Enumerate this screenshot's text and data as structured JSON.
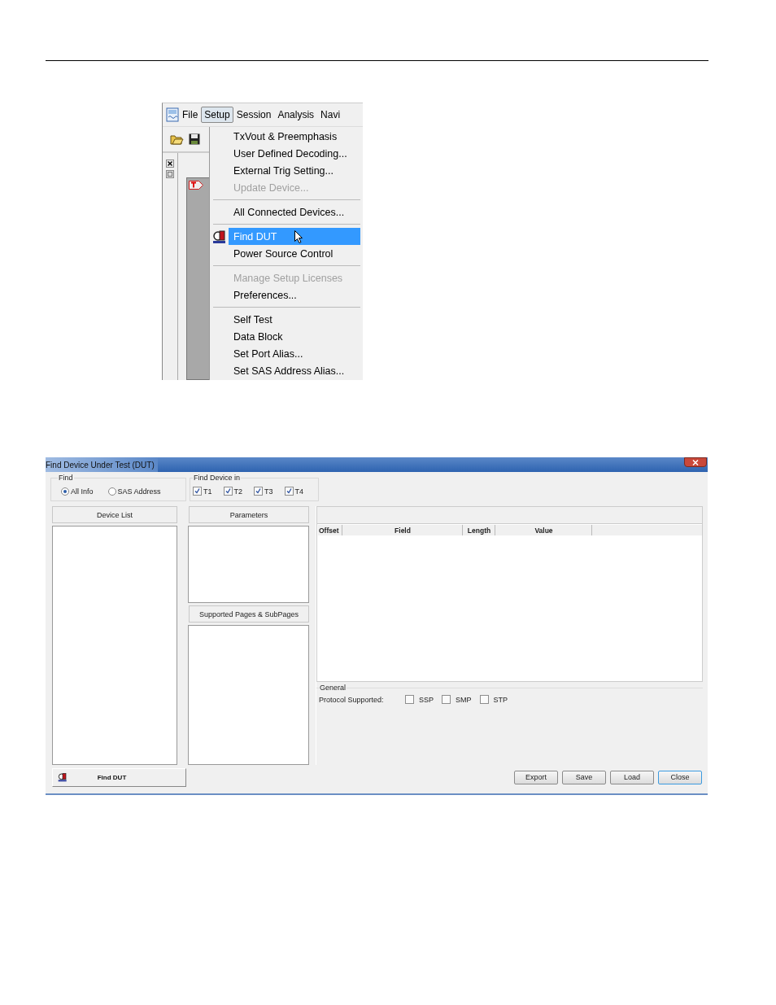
{
  "menu_screenshot": {
    "menubar": [
      {
        "label": "File",
        "selected": false
      },
      {
        "label": "Setup",
        "selected": true
      },
      {
        "label": "Session",
        "selected": false
      },
      {
        "label": "Analysis",
        "selected": false
      },
      {
        "label": "Navi",
        "selected": false
      }
    ],
    "menu_items": [
      {
        "kind": "item",
        "label": "TxVout & Preemphasis",
        "disabled": false,
        "selected": false
      },
      {
        "kind": "item",
        "label": "User Defined Decoding...",
        "disabled": false,
        "selected": false
      },
      {
        "kind": "item",
        "label": "External Trig Setting...",
        "disabled": false,
        "selected": false
      },
      {
        "kind": "item",
        "label": "Update Device...",
        "disabled": true,
        "selected": false
      },
      {
        "kind": "separator"
      },
      {
        "kind": "item",
        "label": "All Connected Devices...",
        "disabled": false,
        "selected": false
      },
      {
        "kind": "separator"
      },
      {
        "kind": "icon_item",
        "label": "Find DUT",
        "disabled": false,
        "selected": true
      },
      {
        "kind": "item",
        "label": "Power Source Control",
        "disabled": false,
        "selected": false
      },
      {
        "kind": "separator"
      },
      {
        "kind": "item",
        "label": "Manage Setup Licenses",
        "disabled": true,
        "selected": false
      },
      {
        "kind": "item",
        "label": "Preferences...",
        "disabled": false,
        "selected": false
      },
      {
        "kind": "separator"
      },
      {
        "kind": "item",
        "label": "Self Test",
        "disabled": false,
        "selected": false
      },
      {
        "kind": "item",
        "label": "Data Block",
        "disabled": false,
        "selected": false
      },
      {
        "kind": "item",
        "label": "Set Port Alias...",
        "disabled": false,
        "selected": false
      },
      {
        "kind": "item",
        "label": "Set SAS Address Alias...",
        "disabled": false,
        "selected": false
      }
    ]
  },
  "dialog": {
    "title": "Find Device Under Test (DUT)",
    "find": {
      "label": "Find",
      "options": [
        {
          "label": "All Info",
          "selected": true
        },
        {
          "label": "SAS Address",
          "selected": false
        }
      ]
    },
    "find_device_in": {
      "label": "Find Device in",
      "ports": [
        {
          "label": "T1",
          "checked": true
        },
        {
          "label": "T2",
          "checked": true
        },
        {
          "label": "T3",
          "checked": true
        },
        {
          "label": "T4",
          "checked": true
        }
      ]
    },
    "device_list": {
      "header": "Device List"
    },
    "parameters": {
      "header": "Parameters"
    },
    "supported_pages": {
      "header": "Supported Pages & SubPages"
    },
    "table": {
      "columns": [
        "Offset",
        "Field",
        "Length",
        "Value"
      ]
    },
    "general": {
      "label": "General",
      "protocol_label": "Protocol Supported:",
      "protocols": [
        {
          "label": "SSP",
          "checked": false
        },
        {
          "label": "SMP",
          "checked": false
        },
        {
          "label": "STP",
          "checked": false
        }
      ]
    },
    "find_button": "Find DUT",
    "buttons": [
      {
        "label": "Export",
        "default": false
      },
      {
        "label": "Save",
        "default": false
      },
      {
        "label": "Load",
        "default": false
      },
      {
        "label": "Close",
        "default": true
      }
    ]
  }
}
